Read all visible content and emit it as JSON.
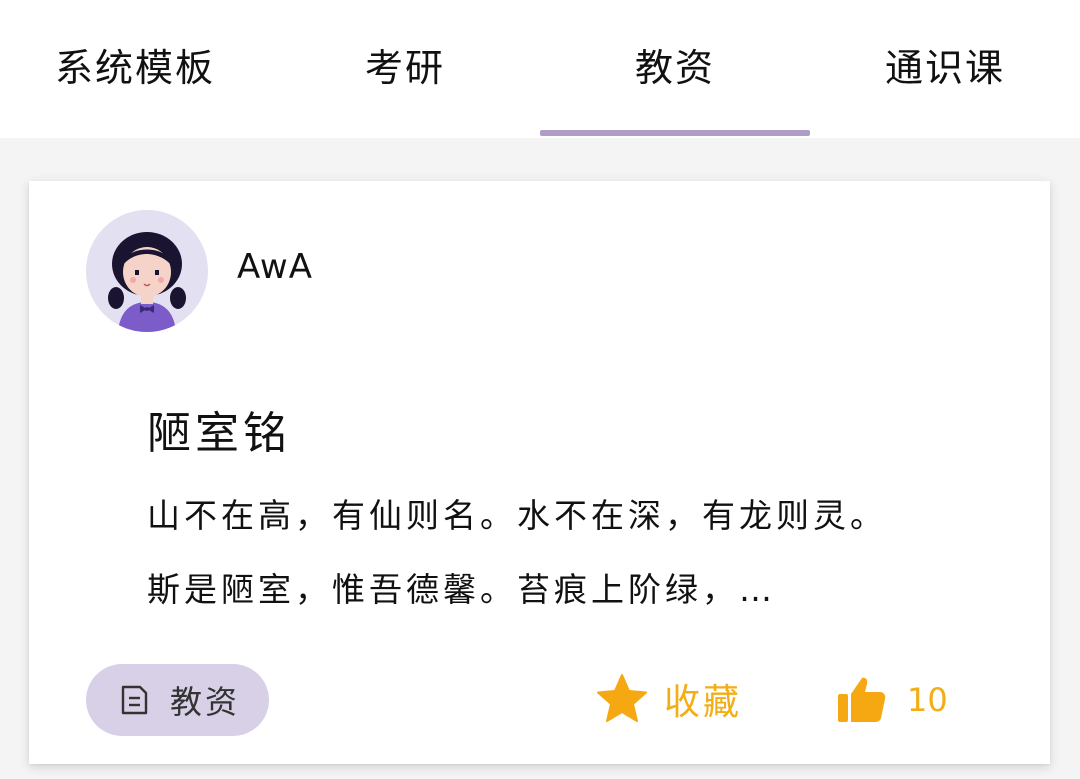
{
  "tabs": [
    {
      "label": "系统模板"
    },
    {
      "label": "考研"
    },
    {
      "label": "教资"
    },
    {
      "label": "通识课"
    }
  ],
  "active_tab_index": 2,
  "post": {
    "author": "AwA",
    "avatar_icon": "girl-avatar-icon",
    "title": "陋室铭",
    "excerpt": "山不在高，有仙则名。水不在深，有龙则灵。斯是陋室，惟吾德馨。苔痕上阶绿，…",
    "category": {
      "label": "教资",
      "icon": "note-icon"
    },
    "favorite": {
      "label": "收藏",
      "icon": "star-icon"
    },
    "like": {
      "count": "10",
      "icon": "thumbs-up-icon"
    }
  },
  "colors": {
    "accent": "#b09cc9",
    "chip_bg": "#d7d0e6",
    "action_yellow": "#f2ae14",
    "page_bg": "#f4f4f5"
  }
}
